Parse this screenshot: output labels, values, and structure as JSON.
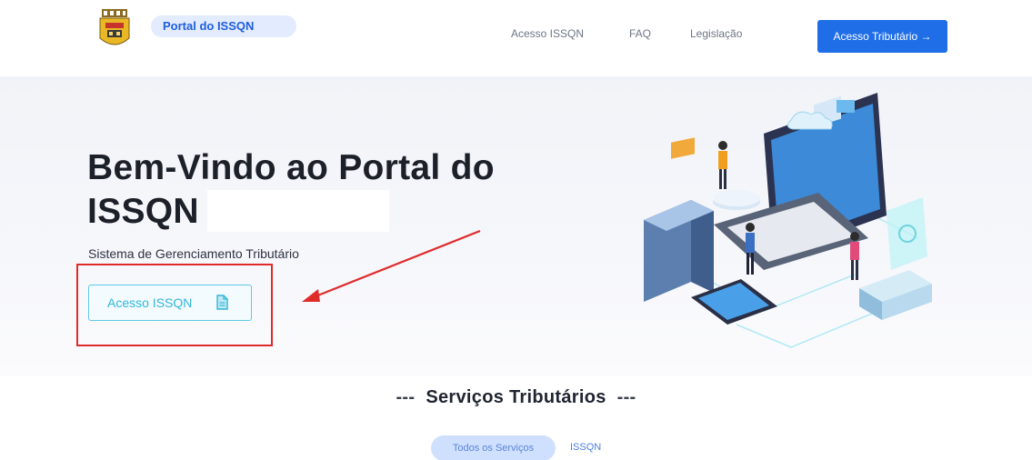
{
  "header": {
    "brand": "Portal do ISSQN",
    "nav": [
      "Acesso ISSQN",
      "FAQ",
      "Legislação"
    ],
    "cta_label": "Acesso Tributário →"
  },
  "hero": {
    "title_line1": "Bem-Vindo ao Portal do",
    "title_line2": "ISSQN",
    "subtitle": "Sistema de Gerenciamento Tributário",
    "button_label": "Acesso ISSQN",
    "button_icon": "document-icon",
    "highlight_color": "#e02b2b"
  },
  "services": {
    "title": "Serviços Tributários",
    "tabs": [
      "Todos os Serviços",
      "ISSQN"
    ],
    "active_tab": "Todos os Serviços"
  },
  "colors": {
    "primary": "#1f6ee8",
    "accent": "#31b6d9",
    "annotation": "#e02b2b"
  }
}
